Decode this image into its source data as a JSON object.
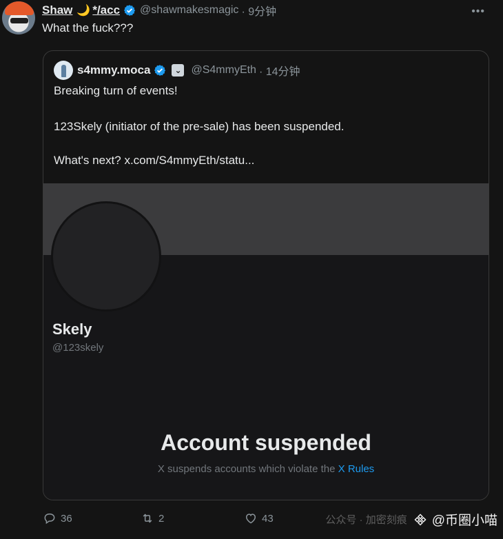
{
  "colors": {
    "background": "#141414",
    "verified": "#1d9bf0",
    "link": "#1d9bf0",
    "muted": "#8b949a"
  },
  "tweet": {
    "author_name": "Shaw",
    "author_suffix": "*/acc",
    "handle": "@shawmakesmagic",
    "time": "· 9分钟",
    "text": "What the fuck???",
    "more_icon": "more-icon"
  },
  "quote": {
    "author_name": "s4mmy.moca",
    "handle": "@S4mmyEth",
    "time": "· 14分钟",
    "line1": "Breaking turn of events!",
    "line2": "123Skely (initiator of the pre-sale) has been suspended.",
    "line3": "What's next?  x.com/S4mmyEth/statu..."
  },
  "suspended_card": {
    "name": "Skely",
    "handle": "@123skely",
    "title": "Account suspended",
    "subtitle": "X suspends accounts which violate the ",
    "link": "X Rules"
  },
  "actions": {
    "replies": "36",
    "retweets": "2",
    "likes": "43"
  },
  "watermark": {
    "faint": "公众号 · 加密刻痕",
    "text": "@币圈小喵"
  }
}
